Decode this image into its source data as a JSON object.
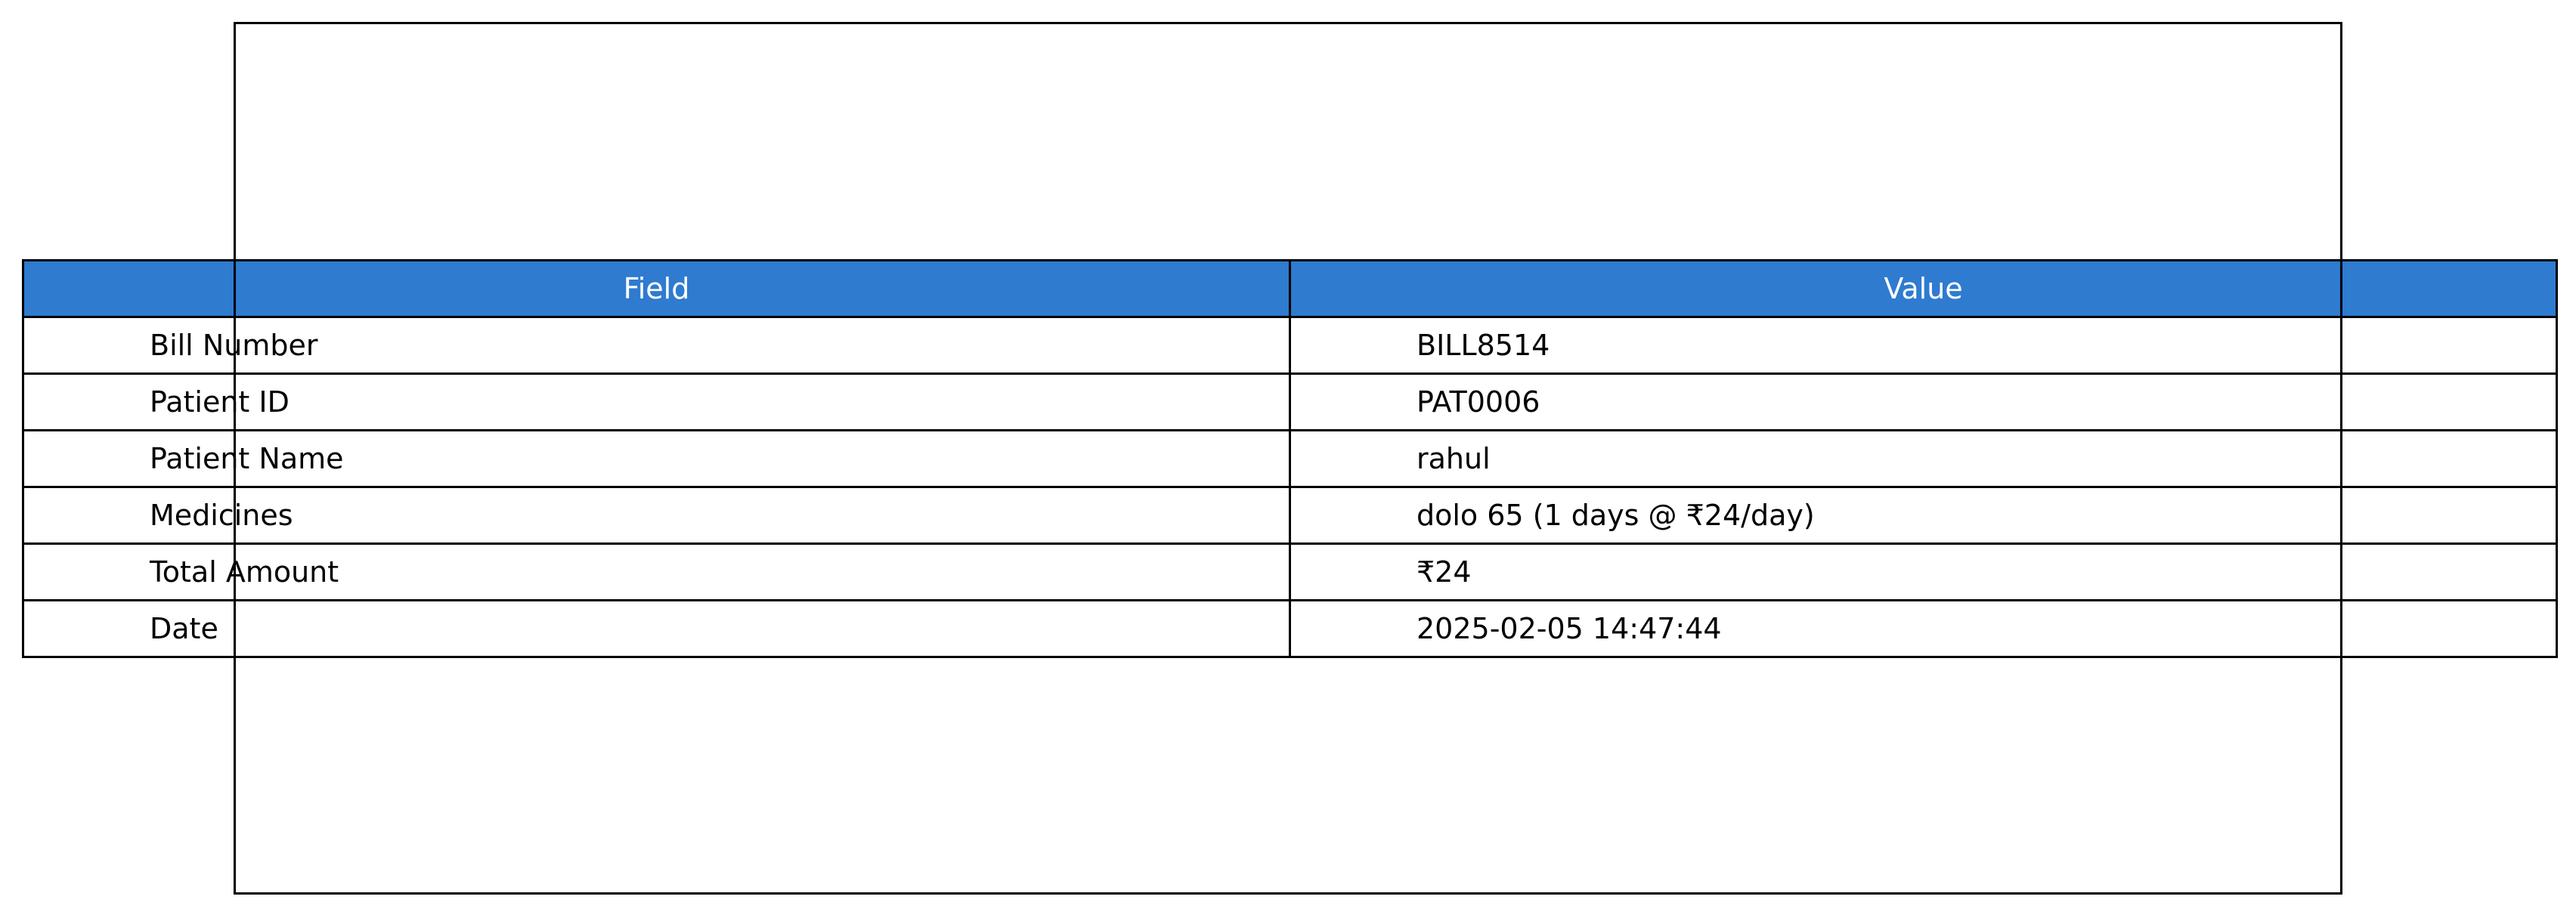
{
  "table": {
    "header_color": "#2e7bd0",
    "columns": [
      "Field",
      "Value"
    ],
    "rows": [
      {
        "field": "Bill Number",
        "value": "BILL8514"
      },
      {
        "field": "Patient ID",
        "value": "PAT0006"
      },
      {
        "field": "Patient Name",
        "value": "rahul"
      },
      {
        "field": "Medicines",
        "value": "dolo 65 (1 days @ ₹24/day)"
      },
      {
        "field": "Total Amount",
        "value": "₹24"
      },
      {
        "field": "Date",
        "value": "2025-02-05 14:47:44"
      }
    ]
  }
}
